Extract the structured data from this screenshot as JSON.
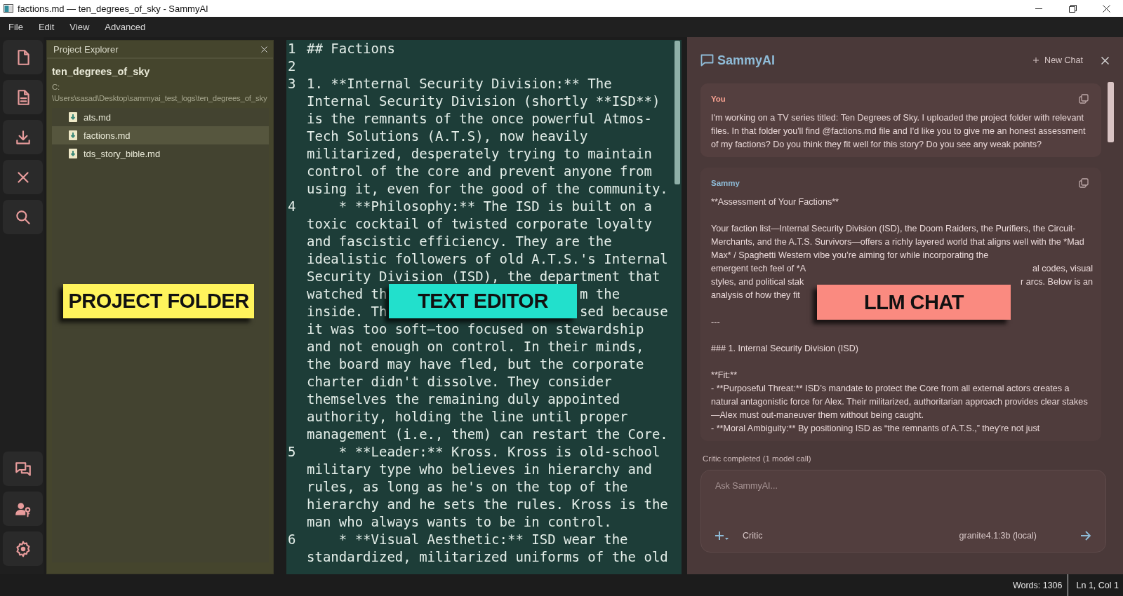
{
  "window": {
    "title": "factions.md — ten_degrees_of_sky - SammyAI"
  },
  "menu": [
    "File",
    "Edit",
    "View",
    "Advanced"
  ],
  "explorer": {
    "title": "Project Explorer",
    "project": "ten_degrees_of_sky",
    "path_lines": [
      "C:",
      "\\Users\\sasad\\Desktop\\sammyai_test_logs\\ten_degrees_of_sky"
    ],
    "files": [
      {
        "name": "ats.md",
        "selected": false
      },
      {
        "name": "factions.md",
        "selected": true
      },
      {
        "name": "tds_story_bible.md",
        "selected": false
      }
    ]
  },
  "editor": {
    "lines": [
      {
        "number": "1",
        "rows": [
          {
            "text": "## Factions"
          }
        ]
      },
      {
        "number": "2"
      },
      {
        "number": "3",
        "rows": [
          {
            "text": "1. **Internal Security Division:** The"
          },
          {
            "text": "Internal Security Division (shortly **ISD**)"
          },
          {
            "text": "is the remnants of the once powerful Atmos-"
          },
          {
            "text": "Tech Solutions (A.T.S), now heavily"
          },
          {
            "text": "militarized, desperately trying to maintain"
          },
          {
            "text": "control of the core and prevent anyone from"
          },
          {
            "text": "using it, even for the good of the community."
          }
        ]
      },
      {
        "number": "4",
        "rows": [
          {
            "text": "    * **Philosophy:** The ISD is built on a"
          },
          {
            "text": "toxic cocktail of twisted corporate loyalty"
          },
          {
            "text": "and fascistic efficiency. They are the"
          },
          {
            "text": "idealistic followers of old A.T.S.'s Internal"
          },
          {
            "text": "Security Division (ISD), the department that"
          },
          {
            "text": "watched th",
            "after_label": "m the"
          },
          {
            "text": "inside. Th",
            "after_label": "sed because"
          },
          {
            "text": "it was too soft—too focused on stewardship"
          },
          {
            "text": "and not enough on control. In their minds,"
          },
          {
            "text": "the board may have fled, but the corporate"
          },
          {
            "text": "charter didn't dissolve. They consider"
          },
          {
            "text": "themselves the remaining duly appointed"
          },
          {
            "text": "authority, holding the line until proper"
          },
          {
            "text": "management (i.e., them) can restart the Core."
          }
        ]
      },
      {
        "number": "5",
        "rows": [
          {
            "text": "    * **Leader:** Kross. Kross is old-school"
          },
          {
            "text": "military type who believes in hierarchy and"
          },
          {
            "text": "rules, as long as he's on the top of the"
          },
          {
            "text": "hierarchy and he sets the rules. Kross is the"
          },
          {
            "text": "man who always wants to be in control."
          }
        ]
      },
      {
        "number": "6",
        "rows": [
          {
            "text": "    * **Visual Aesthetic:** ISD wear the"
          },
          {
            "text": "standardized, militarized uniforms of the old"
          }
        ]
      }
    ]
  },
  "chat": {
    "title": "SammyAI",
    "new_chat": "New Chat",
    "messages": [
      {
        "kind": "user",
        "author": "You",
        "groups": [
          [
            {
              "text": "I'm working on a TV series titled: Ten Degrees of Sky. I uploaded the project folder with relevant files. In that folder you'll find @factions.md file and I'd like you to give me an honest assessment of my factions? Do you think they fit well for this story? Do you see any weak points?"
            }
          ]
        ]
      },
      {
        "kind": "assistant",
        "author": "Sammy",
        "groups": [
          [
            {
              "text": "**Assessment of Your Factions**"
            }
          ],
          [
            {
              "text": "Your faction list—Internal Security Division (ISD), the Doom Raiders, the Purifiers, the Circuit-Merchants, and the A.T.S. Survivors—offers a richly layered world that aligns well with the *Mad Max* / Spaghetti Western vibe you’re aiming for while incorporating the"
            },
            {
              "text": "emergent tech feel of *A",
              "after_label": "al codes, visual"
            },
            {
              "text": "styles, and political stak",
              "after_label": "r arcs. Below is an"
            },
            {
              "text": "analysis of how they fit"
            }
          ],
          [
            {
              "text": "---"
            }
          ],
          [
            {
              "text": "### 1. Internal Security Division (ISD)"
            }
          ],
          [
            {
              "text": "**Fit:**"
            },
            {
              "text": "- **Purposeful Threat:** ISD’s mandate to protect the Core from all external actors creates a natural antagonistic force for Alex. Their militarized, authoritarian approach provides clear stakes—Alex must out-maneuver them without being caught."
            },
            {
              "text": "- **Moral Ambiguity:** By positioning ISD as “the remnants of A.T.S.,” they’re not just"
            }
          ]
        ]
      }
    ],
    "status_note": "Critic completed (1 model call)",
    "input": {
      "placeholder": "Ask SammyAI...",
      "mode": "Critic",
      "model": "granite4.1:3b (local)"
    }
  },
  "status_bar": {
    "words": "Words: 1306",
    "position": "Ln 1, Col 1"
  },
  "annotations": [
    {
      "text": "PROJECT FOLDER",
      "color": "#fff45c"
    },
    {
      "text": "TEXT EDITOR",
      "color": "#22e0cc"
    },
    {
      "text": "LLM CHAT",
      "color": "#fa8a80"
    }
  ]
}
